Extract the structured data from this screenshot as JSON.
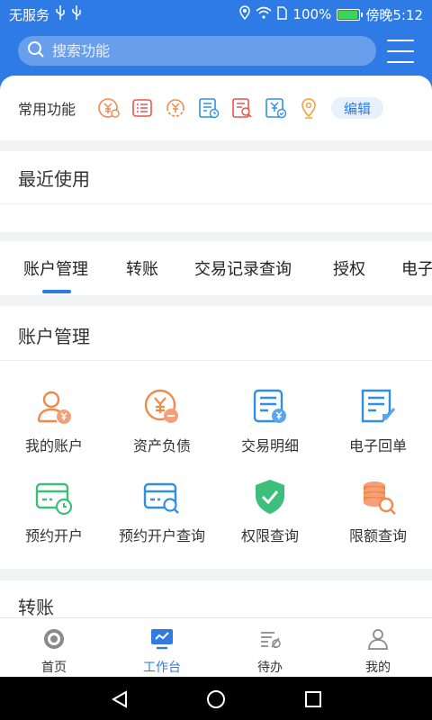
{
  "status": {
    "carrier": "无服务",
    "battery": "100%",
    "time": "傍晚5:12",
    "battery_level": 1.0
  },
  "search": {
    "placeholder": "搜索功能"
  },
  "quick": {
    "label": "常用功能",
    "edit_label": "编辑",
    "icons": [
      "yuan-coin-icon",
      "list-icon",
      "yuan-transfer-icon",
      "document-clock-icon",
      "document-search-icon",
      "yuan-check-icon",
      "location-pin-icon"
    ]
  },
  "recent": {
    "title": "最近使用"
  },
  "tabs": [
    {
      "label": "账户管理",
      "active": true
    },
    {
      "label": "转账"
    },
    {
      "label": "交易记录查询"
    },
    {
      "label": "授权"
    },
    {
      "label": "电子"
    }
  ],
  "account_section": {
    "title": "账户管理",
    "items": [
      {
        "label": "我的账户",
        "icon": "user-yuan-icon"
      },
      {
        "label": "资产负债",
        "icon": "yuan-minus-icon"
      },
      {
        "label": "交易明细",
        "icon": "document-yuan-icon"
      },
      {
        "label": "电子回单",
        "icon": "document-edit-icon"
      },
      {
        "label": "预约开户",
        "icon": "card-clock-icon"
      },
      {
        "label": "预约开户查询",
        "icon": "card-search-icon"
      },
      {
        "label": "权限查询",
        "icon": "shield-check-icon"
      },
      {
        "label": "限额查询",
        "icon": "coins-search-icon"
      }
    ]
  },
  "transfer_section": {
    "title": "转账"
  },
  "bottom_nav": [
    {
      "label": "首页",
      "icon": "home-coin-icon"
    },
    {
      "label": "工作台",
      "icon": "workbench-icon",
      "active": true
    },
    {
      "label": "待办",
      "icon": "todo-list-icon"
    },
    {
      "label": "我的",
      "icon": "person-icon"
    }
  ],
  "colors": {
    "primary": "#2f7be6",
    "orange": "#f08a4b",
    "green": "#3cbf7a",
    "blue": "#2f8fe6"
  }
}
